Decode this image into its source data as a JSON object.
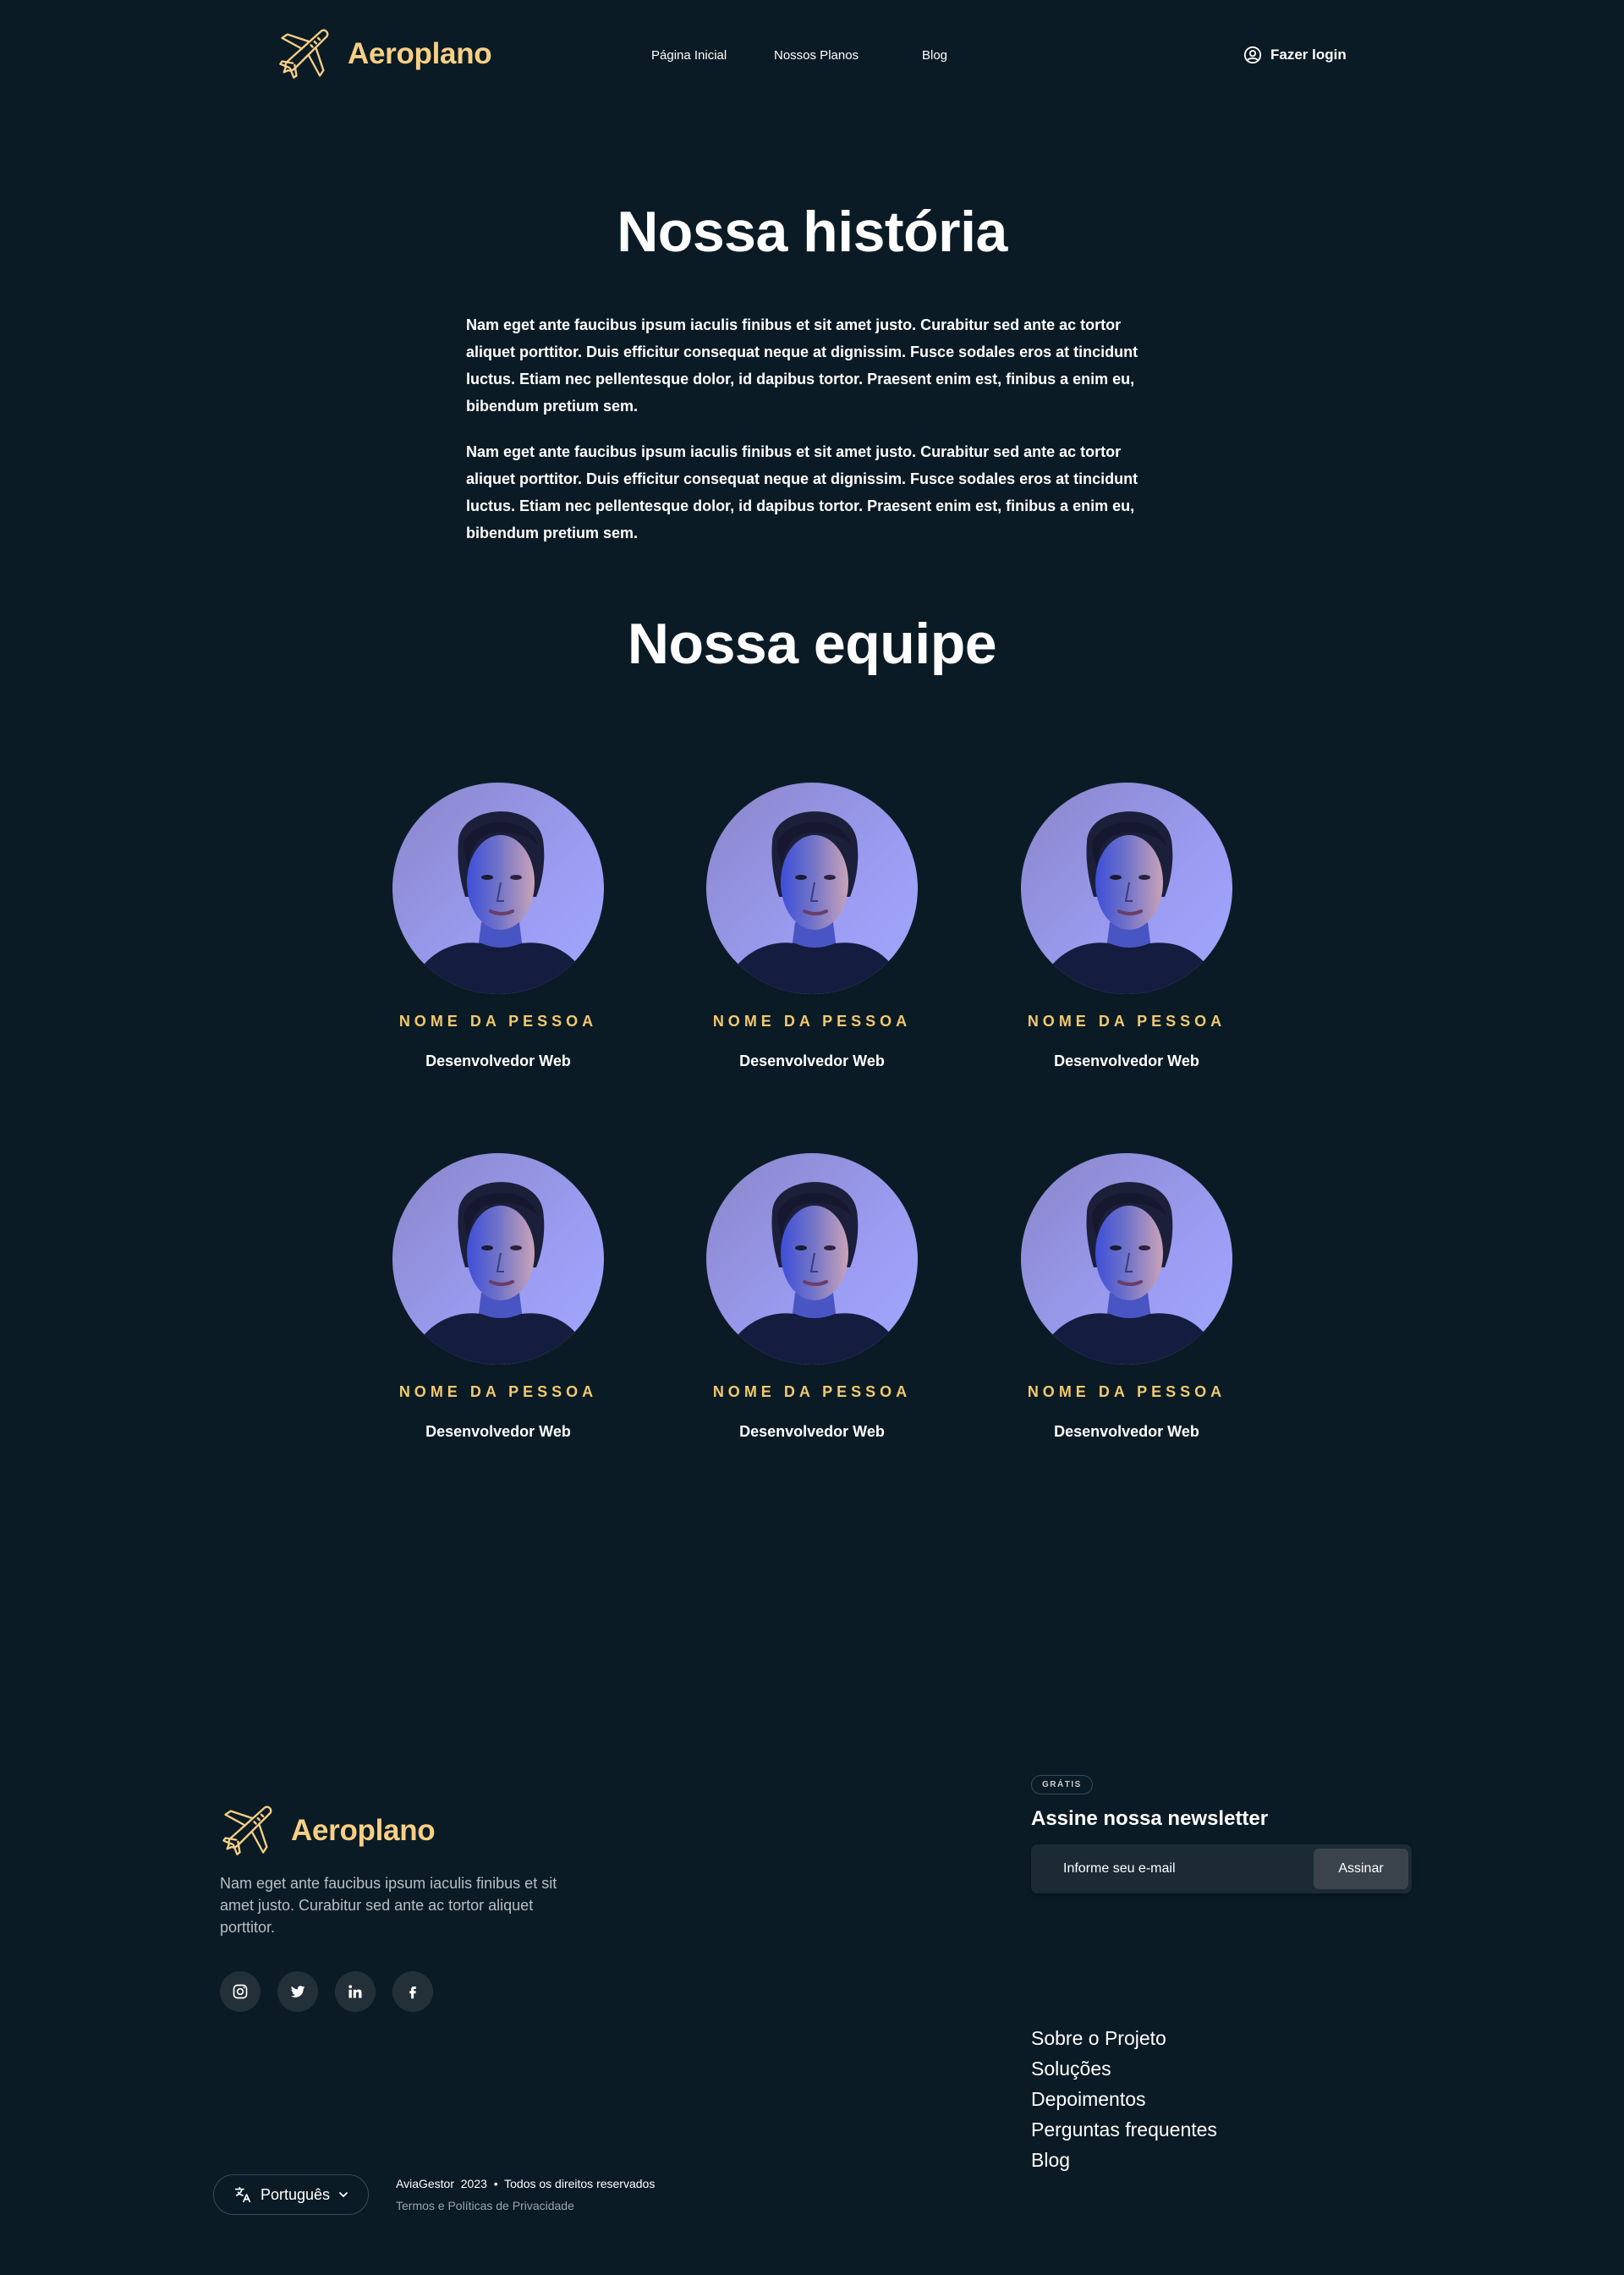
{
  "header": {
    "brand": "Aeroplano",
    "nav": [
      {
        "label": "Página Inicial"
      },
      {
        "label": "Nossos Planos"
      },
      {
        "label": "Blog"
      }
    ],
    "login_label": "Fazer login"
  },
  "story": {
    "title": "Nossa história",
    "paragraphs": [
      "Nam eget ante faucibus ipsum iaculis finibus et sit amet justo. Curabitur sed ante ac tortor aliquet porttitor. Duis efficitur consequat neque at dignissim. Fusce sodales eros at tincidunt luctus. Etiam nec pellentesque dolor, id dapibus tortor. Praesent enim est, finibus a enim eu, bibendum pretium sem.",
      "Nam eget ante faucibus ipsum iaculis finibus et sit amet justo. Curabitur sed ante ac tortor aliquet porttitor. Duis efficitur consequat neque at dignissim. Fusce sodales eros at tincidunt luctus. Etiam nec pellentesque dolor, id dapibus tortor. Praesent enim est, finibus a enim eu, bibendum pretium sem."
    ]
  },
  "team": {
    "title": "Nossa equipe",
    "members": [
      {
        "name": "NOME DA PESSOA",
        "role": "Desenvolvedor Web"
      },
      {
        "name": "NOME DA PESSOA",
        "role": "Desenvolvedor Web"
      },
      {
        "name": "NOME DA PESSOA",
        "role": "Desenvolvedor Web"
      },
      {
        "name": "NOME DA PESSOA",
        "role": "Desenvolvedor Web"
      },
      {
        "name": "NOME DA PESSOA",
        "role": "Desenvolvedor Web"
      },
      {
        "name": "NOME DA PESSOA",
        "role": "Desenvolvedor Web"
      }
    ]
  },
  "footer": {
    "brand": "Aeroplano",
    "description": "Nam eget ante faucibus ipsum iaculis finibus et sit amet justo. Curabitur sed ante ac tortor aliquet porttitor.",
    "social_icons": [
      "instagram-icon",
      "twitter-icon",
      "linkedin-icon",
      "facebook-icon"
    ],
    "newsletter": {
      "badge": "GRÁTIS",
      "title": "Assine nossa newsletter",
      "placeholder": "Informe seu e-mail",
      "button": "Assinar"
    },
    "links": [
      "Sobre o Projeto",
      "Soluções",
      "Depoimentos",
      "Perguntas frequentes",
      "Blog"
    ],
    "language": "Português",
    "copyright": "AviaGestor  2023  •  Todos os direitos reservados",
    "terms": "Termos e Políticas de Privacidade"
  },
  "colors": {
    "background": "#0b1b25",
    "brand": "#f7cf84",
    "member_name": "#f3c96f"
  }
}
